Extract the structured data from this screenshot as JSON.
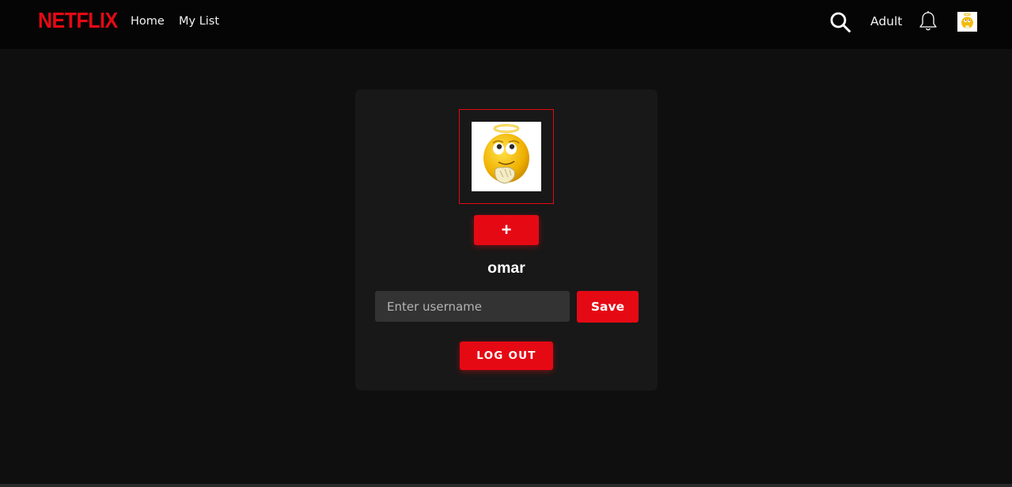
{
  "navbar": {
    "logo_text": "NETFLIX",
    "links": [
      {
        "label": "Home"
      },
      {
        "label": "My List"
      }
    ],
    "profile_mode": "Adult",
    "icons": {
      "search": "search-icon",
      "notifications": "bell-icon",
      "avatar": "halo-emoji-avatar"
    }
  },
  "profile": {
    "avatar_icon": "halo-emoji-avatar",
    "add_label": "+",
    "username": "omar",
    "input_placeholder": "Enter username",
    "input_value": "",
    "save_label": "Save",
    "logout_label": "LOG OUT"
  },
  "colors": {
    "accent": "#e50914",
    "background": "#0f0f0f",
    "navbar": "#050505",
    "card": "#181818",
    "input": "#333333"
  }
}
